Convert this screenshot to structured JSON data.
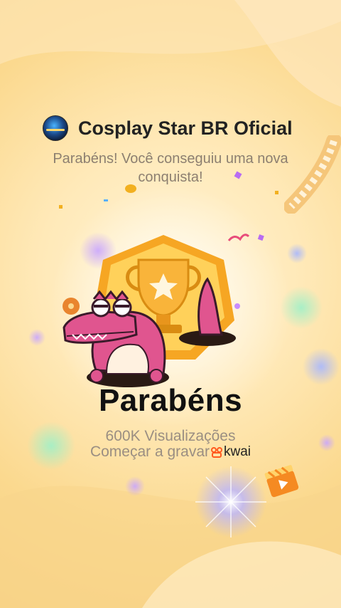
{
  "header": {
    "account_name": "Cosplay Star BR Oficial",
    "avatar_icon": "account-avatar-icon"
  },
  "subtitle": "Parabéns! Você conseguiu uma nova conquista!",
  "achievement": {
    "title": "Parabéns",
    "views": "600K Visualizações",
    "record_label": "Começar a gravar",
    "brand": "kwai"
  },
  "colors": {
    "background": "#fbd98f",
    "text_dark": "#111111",
    "text_muted": "#9a8e82",
    "brand": "#ff5a1f",
    "crocodile": "#e0558f",
    "trophy": "#f6b93b"
  },
  "icons": [
    "trophy-icon",
    "crocodile-mascot-icon",
    "film-strip-icon",
    "clapperboard-icon",
    "kwai-logo-icon",
    "sparkle-icon"
  ]
}
